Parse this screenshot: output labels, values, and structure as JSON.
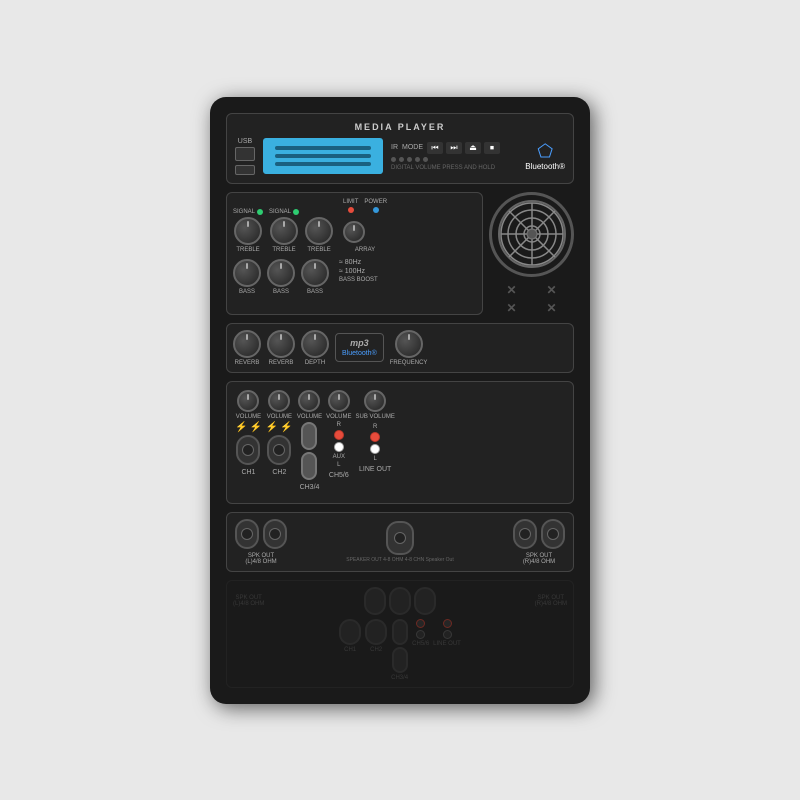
{
  "device": {
    "title": "MEDIA PLAYER",
    "bluetooth_label": "Bluetooth®",
    "usb_label": "USB",
    "ir_label": "IR",
    "mode_label": "MODE",
    "controls": [
      "⏮",
      "⏭",
      "⏏",
      "⏹"
    ],
    "channels": {
      "ch1": {
        "label": "CH1",
        "has_signal": true,
        "treble": "TREBLE",
        "bass": "BASS",
        "volume": "VOLUME"
      },
      "ch2": {
        "label": "CH2",
        "has_signal": true,
        "treble": "TREBLE",
        "bass": "BASS",
        "volume": "VOLUME"
      },
      "ch3": {
        "label": "CH3/4",
        "treble": "TREBLE",
        "bass": "BASS",
        "volume": "VOLUME"
      },
      "ch56": {
        "label": "CH5/6",
        "volume": "VOLUME"
      }
    },
    "eq_labels": {
      "reverb": "REVERB",
      "depth": "DEPTH",
      "frequency": "FREQUENCY",
      "sub_volume": "SUB VOLUME",
      "array": "ARRAY",
      "bass_boost": "BASS BOOST",
      "limit": "LIMIT",
      "power": "POWER"
    },
    "bass_boost_freqs": [
      "80Hz",
      "100Hz"
    ],
    "mp3_label": "mp3",
    "bluetooth_small": "Bluetooth®",
    "aux_label": "AUX",
    "line_out_label": "LINE OUT",
    "spk_out_left": "SPK OUT\n(L)4/8 OHM",
    "spk_out_right": "SPK OUT\n(R)4/8 OHM",
    "speaker_out_text": "SPEAKER OUT\n4-8 OHM\n4-8 CHN\nSpeaker Out"
  }
}
